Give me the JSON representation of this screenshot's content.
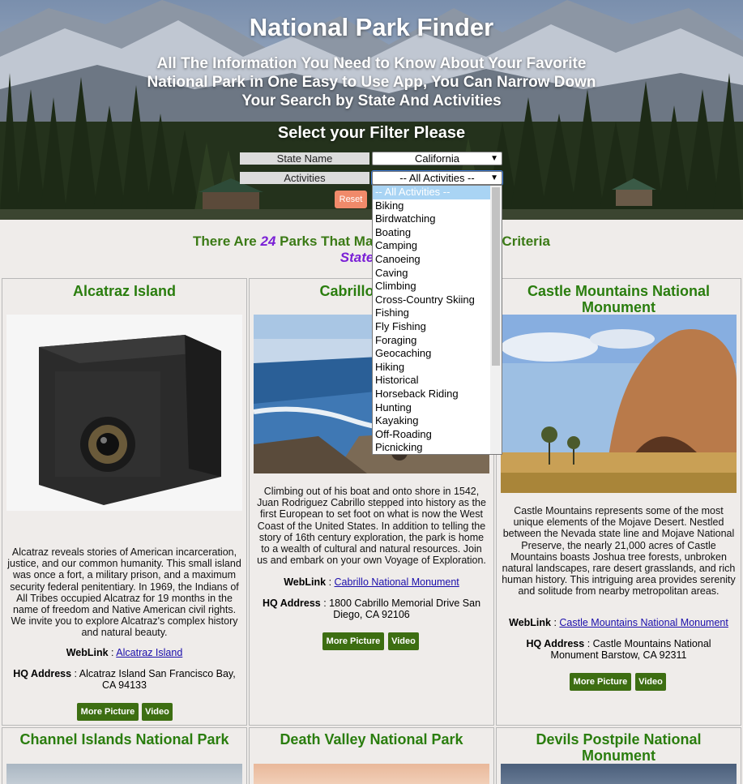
{
  "header": {
    "title": "National Park Finder",
    "subtitle": "All The Information You Need to Know About Your Favorite National Park in One Easy to Use App, You Can Narrow Down Your Search by State And Activities",
    "filter_title": "Select your Filter Please"
  },
  "filters": {
    "state_label": "State Name",
    "state_value": "California",
    "activities_label": "Activities",
    "activities_value": "-- All Activities --",
    "reset_label": "Reset",
    "activity_options": [
      "-- All Activities --",
      "Biking",
      "Birdwatching",
      "Boating",
      "Camping",
      "Canoeing",
      "Caving",
      "Climbing",
      "Cross-Country Skiing",
      "Fishing",
      "Fly Fishing",
      "Foraging",
      "Geocaching",
      "Hiking",
      "Historical",
      "Horseback Riding",
      "Hunting",
      "Kayaking",
      "Off-Roading",
      "Picnicking"
    ]
  },
  "results": {
    "prefix": "There Are ",
    "count": "24",
    "suffix_visible_left": " Parks That Ma",
    "suffix_visible_right": "Criteria",
    "state_code": "StateCode = CA"
  },
  "cards": [
    {
      "title": "Alcatraz Island",
      "desc": "Alcatraz reveals stories of American incarceration, justice, and our common humanity. This small island was once a fort, a military prison, and a maximum security federal penitentiary. In 1969, the Indians of All Tribes occupied Alcatraz for 19 months in the name of freedom and Native American civil rights. We invite you to explore Alcatraz's complex history and natural beauty.",
      "weblink_label": "WebLink",
      "weblink_text": "Alcatraz Island",
      "hq_label": "HQ Address",
      "hq_text": "Alcatraz Island San Francisco Bay, CA 94133",
      "btn_more": "More Picture",
      "btn_video": "Video"
    },
    {
      "title": "Cabrillo National Monument",
      "title_visible": "Cabrillo Nation",
      "desc": "Climbing out of his boat and onto shore in 1542, Juan Rodriguez Cabrillo stepped into history as the first European to set foot on what is now the West Coast of the United States. In addition to telling the story of 16th century exploration, the park is home to a wealth of cultural and natural resources. Join us and embark on your own Voyage of Exploration.",
      "weblink_label": "WebLink",
      "weblink_text": "Cabrillo National Monument",
      "hq_label": "HQ Address",
      "hq_text": "1800 Cabrillo Memorial Drive San Diego, CA 92106",
      "btn_more": "More Picture",
      "btn_video": "Video"
    },
    {
      "title": "Castle Mountains National Monument",
      "desc": "Castle Mountains represents some of the most unique elements of the Mojave Desert. Nestled between the Nevada state line and Mojave National Preserve, the nearly 21,000 acres of Castle Mountains boasts Joshua tree forests, unbroken natural landscapes, rare desert grasslands, and rich human history. This intriguing area provides serenity and solitude from nearby metropolitan areas.",
      "weblink_label": "WebLink",
      "weblink_text": "Castle Mountains National Monument",
      "hq_label": "HQ Address",
      "hq_text": "Castle Mountains National Monument Barstow, CA 92311",
      "btn_more": "More Picture",
      "btn_video": "Video"
    },
    {
      "title": "Channel Islands National Park"
    },
    {
      "title": "Death Valley National Park"
    },
    {
      "title": "Devils Postpile National Monument"
    }
  ],
  "colors": {
    "title_green": "#2a7d0e",
    "count_purple": "#7a1fd6",
    "button_green": "#3d6e12",
    "reset_orange": "#f08a6a"
  }
}
